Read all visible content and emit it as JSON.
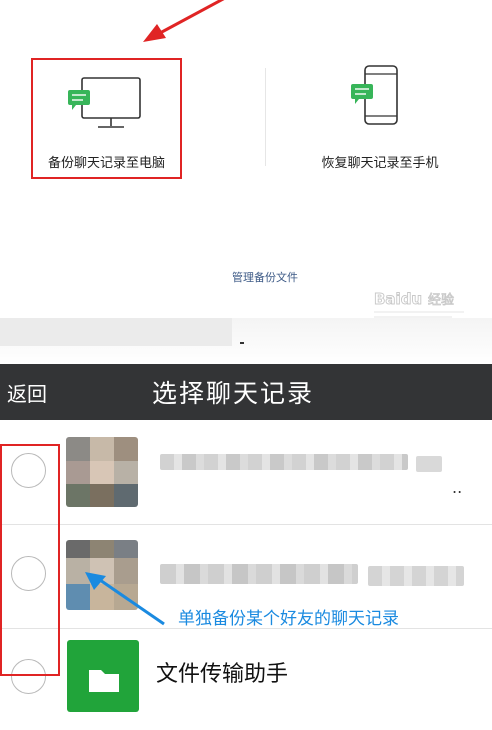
{
  "backup_panel": {
    "backup_option_label": "备份聊天记录至电脑",
    "restore_option_label": "恢复聊天记录至手机",
    "manage_link": "管理备份文件"
  },
  "watermark": {
    "text": "Baidu 经验"
  },
  "select_screen": {
    "back_label": "返回",
    "title": "选择聊天记录",
    "items": [
      {
        "name": "",
        "type": "contact"
      },
      {
        "name": "",
        "type": "contact"
      },
      {
        "name": "文件传输助手",
        "type": "file-transfer"
      }
    ]
  },
  "annotations": {
    "tip": "单独备份某个好友的聊天记录"
  },
  "colors": {
    "highlight_red": "#e02424",
    "annotation_blue": "#1a8ae0",
    "nav_bar": "#333436",
    "wechat_green": "#21a43a"
  },
  "icons": {
    "backup": "monitor-chat-icon",
    "restore": "phone-chat-icon",
    "file_transfer": "folder-icon"
  }
}
